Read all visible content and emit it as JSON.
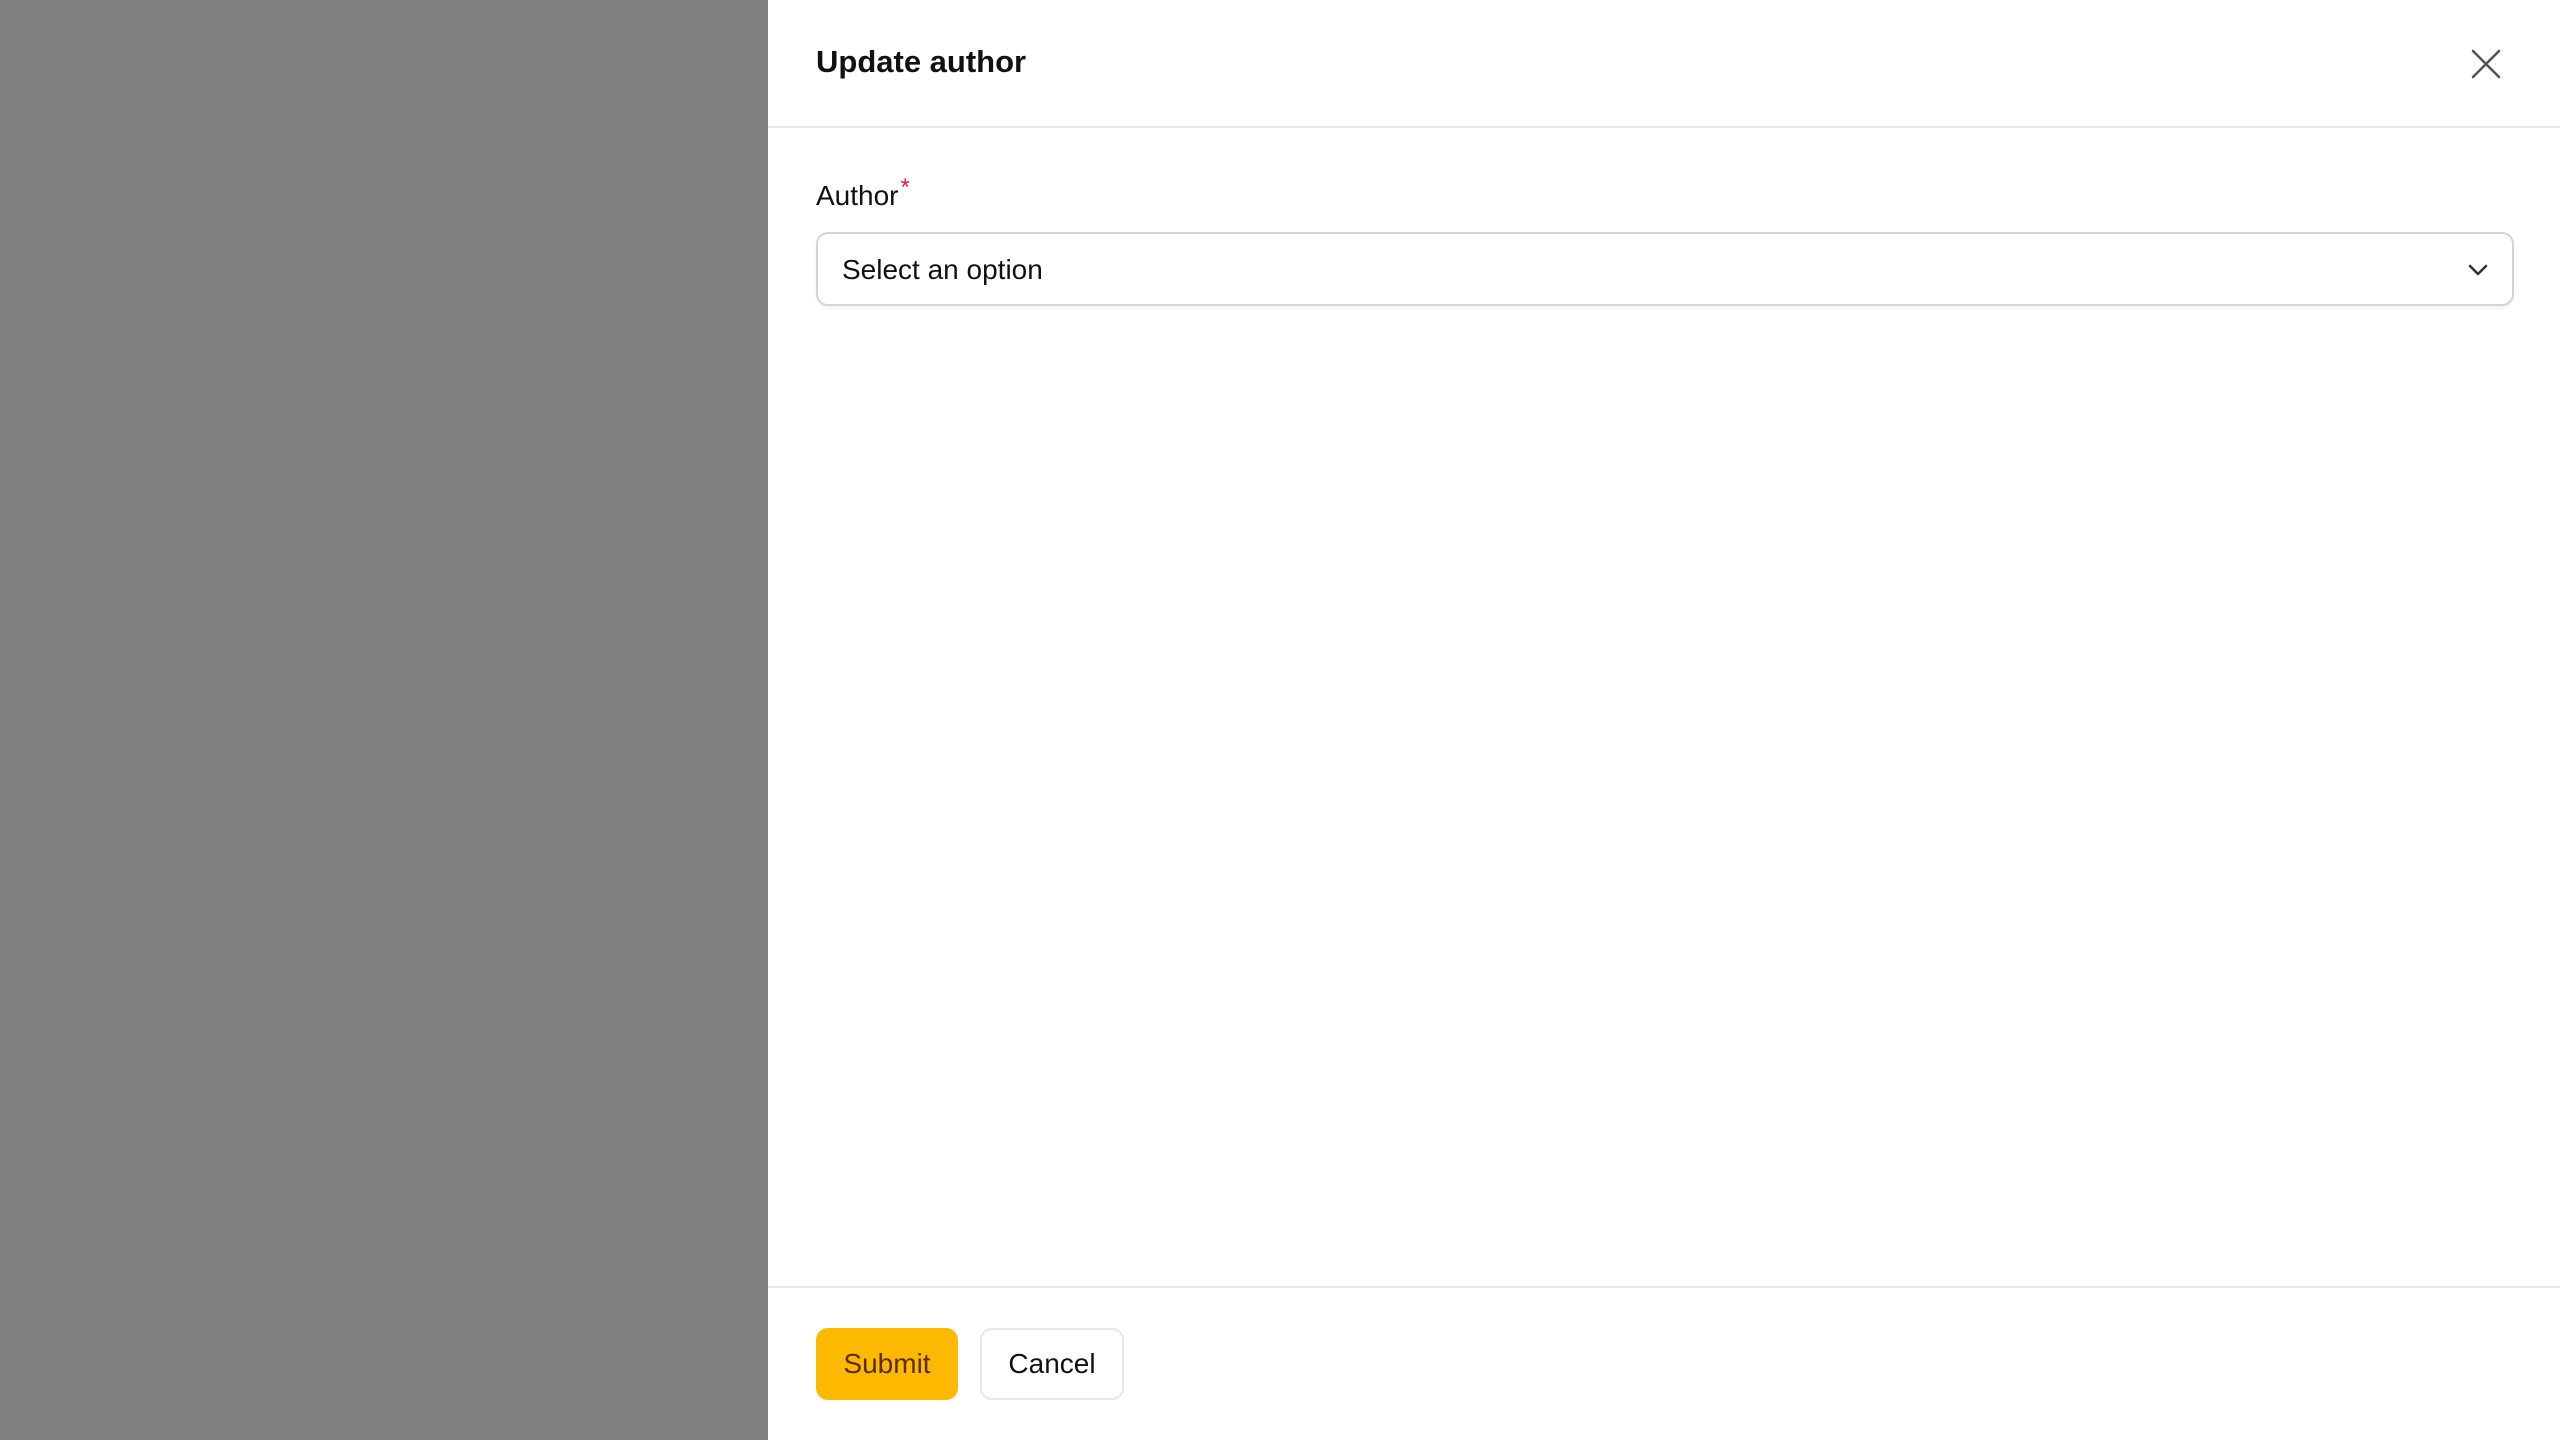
{
  "drawer": {
    "title": "Update author",
    "close_icon": "close-icon"
  },
  "form": {
    "author": {
      "label": "Author",
      "required_marker": "*",
      "value": "Select an option",
      "icon": "chevron-down-icon"
    }
  },
  "footer": {
    "submit_label": "Submit",
    "cancel_label": "Cancel"
  },
  "colors": {
    "backdrop": "#808080",
    "primary": "#fcb900",
    "required": "#e11d48"
  }
}
